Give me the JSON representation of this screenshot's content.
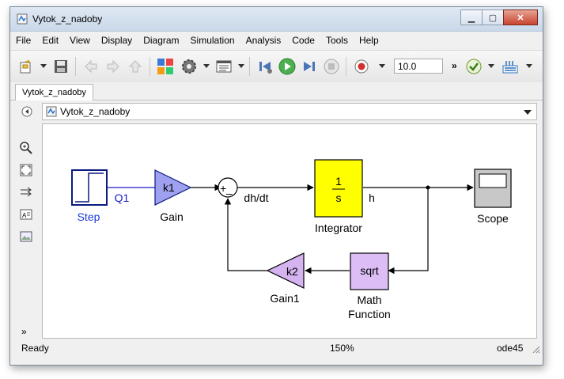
{
  "window": {
    "title": "Vytok_z_nadoby"
  },
  "window_buttons": {
    "minimize": "▁",
    "maximize": "▢",
    "close": "✕"
  },
  "menu": [
    "File",
    "Edit",
    "View",
    "Display",
    "Diagram",
    "Simulation",
    "Analysis",
    "Code",
    "Tools",
    "Help"
  ],
  "toolbar": {
    "stop_time": "10.0",
    "more": "»"
  },
  "tab": {
    "label": "Vytok_z_nadoby"
  },
  "breadcrumb": {
    "label": "Vytok_z_nadoby"
  },
  "palette": {
    "more": "»"
  },
  "diagram": {
    "step": {
      "label": "Step"
    },
    "gain": {
      "value": "k1",
      "label": "Gain"
    },
    "gain1": {
      "value": "k2",
      "label": "Gain1"
    },
    "sum": {
      "plus": "+",
      "minus": "–"
    },
    "integrator": {
      "numerator": "1",
      "denominator": "s",
      "label": "Integrator"
    },
    "scope": {
      "label": "Scope"
    },
    "math": {
      "value": "sqrt",
      "label_line1": "Math",
      "label_line2": "Function"
    },
    "signals": {
      "q1": "Q1",
      "dhdt": "dh/dt",
      "h": "h"
    },
    "colors": {
      "step": "#0a1a80",
      "gain": "#a0a0f0",
      "gain1": "#d4b3f0",
      "integrator": "#ffff00",
      "math": "#dcbdf5",
      "scope": "#c8c8c8"
    }
  },
  "status": {
    "state": "Ready",
    "zoom": "150%",
    "solver": "ode45"
  }
}
